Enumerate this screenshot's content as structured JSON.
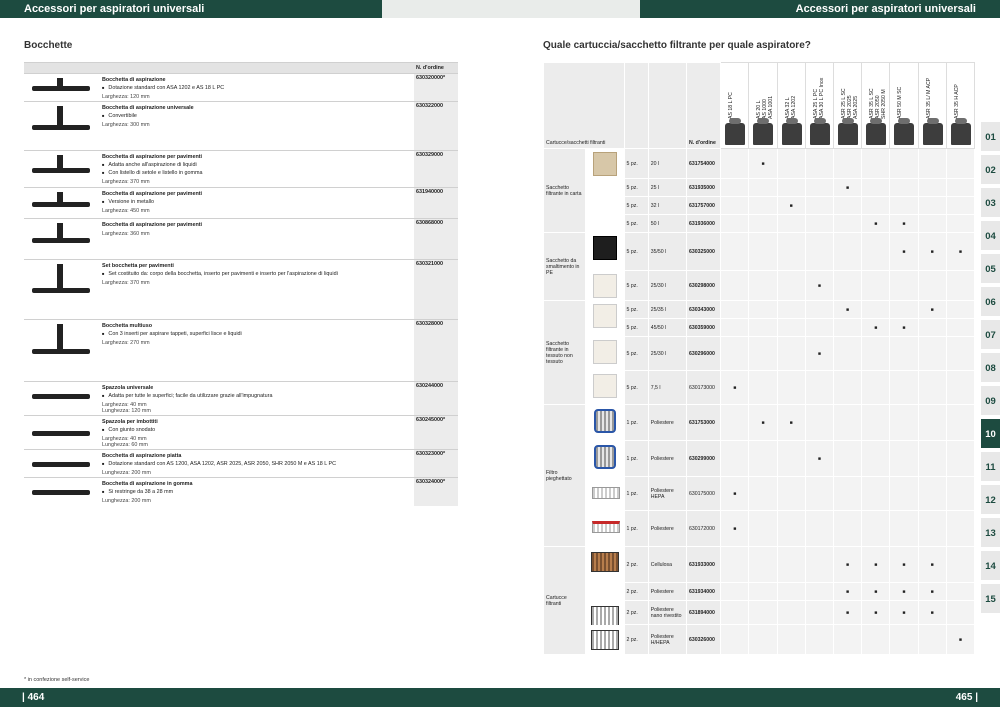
{
  "header": {
    "left_title": "Accessori per aspiratori universali",
    "right_title": "Accessori per aspiratori universali"
  },
  "left": {
    "section_title": "Bocchette",
    "order_header": "N. d'ordine",
    "products": [
      {
        "name": "Bocchetta di aspirazione",
        "bullets": [
          "Dotazione standard con ASA 1202 e AS 18 L PC"
        ],
        "dims": [
          "Larghezza: 120 mm"
        ],
        "order": "630320000*"
      },
      {
        "name": "Bocchetta di aspirazione universale",
        "bullets": [
          "Convertibile"
        ],
        "dims": [
          "Larghezza: 300 mm"
        ],
        "order": "630322000"
      },
      {
        "name": "Bocchetta di aspirazione per pavimenti",
        "bullets": [
          "Adatta anche all'aspirazione di liquidi",
          "Con listello di setole e listello in gomma"
        ],
        "dims": [
          "Larghezza: 370 mm"
        ],
        "order": "630329000"
      },
      {
        "name": "Bocchetta di aspirazione per pavimenti",
        "bullets": [
          "Versione in metallo"
        ],
        "dims": [
          "Larghezza: 450 mm"
        ],
        "order": "631940000"
      },
      {
        "name": "Bocchetta di aspirazione per pavimenti",
        "bullets": [],
        "dims": [
          "Larghezza: 360 mm"
        ],
        "order": "630868000"
      },
      {
        "name": "Set bocchetta per pavimenti",
        "bullets": [
          "Set costituito da: corpo della bocchetta, inserto per pavimenti e inserto per l'aspirazione di liquidi"
        ],
        "dims": [
          "Larghezza: 370 mm"
        ],
        "order": "630321000"
      },
      {
        "name": "Bocchetta multiuso",
        "bullets": [
          "Con 3 inserti per aspirare tappeti, superfici lisce e liquidi"
        ],
        "dims": [
          "Larghezza: 270 mm"
        ],
        "order": "630328000"
      },
      {
        "name": "Spazzola universale",
        "bullets": [
          "Adatta per tutte le superfici; facile da utilizzare grazie all'impugnatura"
        ],
        "dims": [
          "Larghezza: 40 mm",
          "Lunghezza: 120 mm"
        ],
        "order": "630244000"
      },
      {
        "name": "Spazzola per imbottiti",
        "bullets": [
          "Con giunto snodato"
        ],
        "dims": [
          "Larghezza: 40 mm",
          "Lunghezza: 60 mm"
        ],
        "order": "630245000*"
      },
      {
        "name": "Bocchetta di aspirazione piatta",
        "bullets": [
          "Dotazione standard con AS 1200, ASA 1202, ASR 2025, ASR 2050, SHR 2050 M e AS 18 L PC"
        ],
        "dims": [
          "Lunghezza: 200 mm"
        ],
        "order": "630323000*"
      },
      {
        "name": "Bocchetta di aspirazione in gomma",
        "bullets": [
          "Si restringe da 38 a 28 mm"
        ],
        "dims": [
          "Lunghezza: 200 mm"
        ],
        "order": "630324000*"
      }
    ],
    "footnote": "* in confezione self-service"
  },
  "right": {
    "section_title": "Quale cartuccia/sacchetto filtrante per quale aspiratore?",
    "col_header": "Cartucce/sacchetti filtranti",
    "order_header": "N. d'ordine",
    "models": [
      "AS 18 L PC",
      "AS 20 L\nAS 1000\nASA 1001",
      "ASA 32 L\nASA 1202",
      "ASA 25 L PC\nASA 30 L PC Inox",
      "ASR 25 L SC\nASR 2025\nASA 2025",
      "ASR 35 L SC\nASR 2050\nSHR 2050 M",
      "ASR 50 M SC",
      "ASR 35 L/ M ACP",
      "ASR 35 H ACP"
    ],
    "mark": "■",
    "rows": [
      {
        "cat": "Sacchetto filtrante in carta",
        "span": 4,
        "pic": "bag",
        "qty": "5 pz.",
        "mat": "20 l",
        "order": "631754000",
        "bold": true,
        "marks": [
          1
        ]
      },
      {
        "qty": "5 pz.",
        "mat": "25 l",
        "order": "631935000",
        "bold": true,
        "marks": [
          4
        ]
      },
      {
        "qty": "5 pz.",
        "mat": "32 l",
        "order": "631757000",
        "bold": true,
        "marks": [
          2
        ]
      },
      {
        "qty": "5 pz.",
        "mat": "50 l",
        "order": "631936000",
        "bold": true,
        "marks": [
          5,
          6
        ]
      },
      {
        "cat": "Sacchetto da smaltimento in PE",
        "span": 2,
        "pic": "bag b",
        "qty": "5 pz.",
        "mat": "35/50 l",
        "order": "630325000",
        "bold": true,
        "marks": [
          6,
          7,
          8
        ]
      },
      {
        "pic": "bag w",
        "qty": "5 pz.",
        "mat": "25/30 l",
        "order": "630298000",
        "bold": true,
        "marks": [
          3
        ]
      },
      {
        "cat": "Sacchetto filtrante in tessuto non tessuto",
        "span": 4,
        "pic": "bag w",
        "qty": "5 pz.",
        "mat": "25/35 l",
        "order": "630343000",
        "bold": true,
        "marks": [
          4,
          7
        ]
      },
      {
        "qty": "5 pz.",
        "mat": "45/50 l",
        "order": "630359000",
        "bold": true,
        "marks": [
          5,
          6
        ]
      },
      {
        "pic": "bag w",
        "qty": "5 pz.",
        "mat": "25/30 l",
        "order": "630296000",
        "bold": true,
        "marks": [
          3
        ]
      },
      {
        "pic": "bag w",
        "qty": "5 pz.",
        "mat": "7,5 l",
        "order": "630173000",
        "bold": false,
        "marks": [
          0
        ]
      },
      {
        "cat": "Filtro pieghettato",
        "span": 4,
        "pic": "filt",
        "qty": "1 pz.",
        "mat": "Poliestere",
        "order": "631753000",
        "bold": true,
        "marks": [
          1,
          2
        ]
      },
      {
        "pic": "filt",
        "qty": "1 pz.",
        "mat": "Poliestere",
        "order": "630299000",
        "bold": true,
        "marks": [
          3
        ]
      },
      {
        "pic": "flat",
        "qty": "1 pz.",
        "mat": "Poliestere HEPA",
        "order": "630175000",
        "bold": false,
        "marks": [
          0
        ]
      },
      {
        "pic": "flat r",
        "qty": "1 pz.",
        "mat": "Poliestere",
        "order": "630172000",
        "bold": false,
        "marks": [
          0
        ]
      },
      {
        "cat": "Cartucce filtranti",
        "span": 4,
        "pic": "cart",
        "qty": "2 pz.",
        "mat": "Cellulosa",
        "order": "631933000",
        "bold": true,
        "marks": [
          4,
          5,
          6,
          7
        ]
      },
      {
        "pic": "",
        "qty": "2 pz.",
        "mat": "Poliestere",
        "order": "631934000",
        "bold": true,
        "marks": [
          4,
          5,
          6,
          7
        ]
      },
      {
        "pic": "cart w",
        "qty": "2 pz.",
        "mat": "Poliestere nano rivestito",
        "order": "631894000",
        "bold": true,
        "marks": [
          4,
          5,
          6,
          7
        ]
      },
      {
        "pic": "cart w",
        "qty": "2 pz.",
        "mat": "Poliestere H/HEPA",
        "order": "630326000",
        "bold": true,
        "marks": [
          8
        ]
      }
    ]
  },
  "tabs": [
    "01",
    "02",
    "03",
    "04",
    "05",
    "06",
    "07",
    "08",
    "09",
    "10",
    "11",
    "12",
    "13",
    "14",
    "15"
  ],
  "active_tab": "10",
  "pages": {
    "left": "| 464",
    "right": "465 |"
  }
}
